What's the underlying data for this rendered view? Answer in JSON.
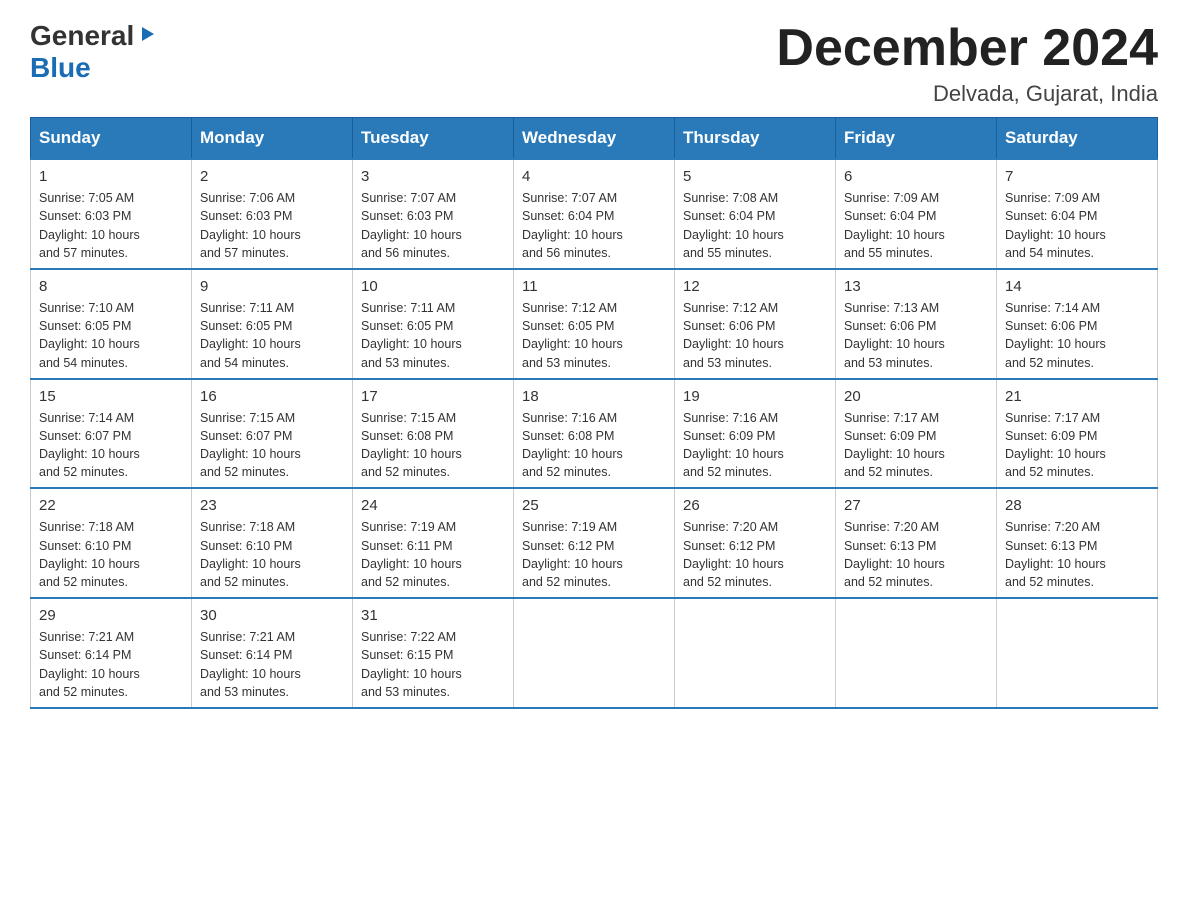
{
  "header": {
    "logo_general": "General",
    "logo_blue": "Blue",
    "month_title": "December 2024",
    "location": "Delvada, Gujarat, India"
  },
  "days_of_week": [
    "Sunday",
    "Monday",
    "Tuesday",
    "Wednesday",
    "Thursday",
    "Friday",
    "Saturday"
  ],
  "weeks": [
    [
      {
        "day": "1",
        "sunrise": "7:05 AM",
        "sunset": "6:03 PM",
        "daylight": "10 hours and 57 minutes."
      },
      {
        "day": "2",
        "sunrise": "7:06 AM",
        "sunset": "6:03 PM",
        "daylight": "10 hours and 57 minutes."
      },
      {
        "day": "3",
        "sunrise": "7:07 AM",
        "sunset": "6:03 PM",
        "daylight": "10 hours and 56 minutes."
      },
      {
        "day": "4",
        "sunrise": "7:07 AM",
        "sunset": "6:04 PM",
        "daylight": "10 hours and 56 minutes."
      },
      {
        "day": "5",
        "sunrise": "7:08 AM",
        "sunset": "6:04 PM",
        "daylight": "10 hours and 55 minutes."
      },
      {
        "day": "6",
        "sunrise": "7:09 AM",
        "sunset": "6:04 PM",
        "daylight": "10 hours and 55 minutes."
      },
      {
        "day": "7",
        "sunrise": "7:09 AM",
        "sunset": "6:04 PM",
        "daylight": "10 hours and 54 minutes."
      }
    ],
    [
      {
        "day": "8",
        "sunrise": "7:10 AM",
        "sunset": "6:05 PM",
        "daylight": "10 hours and 54 minutes."
      },
      {
        "day": "9",
        "sunrise": "7:11 AM",
        "sunset": "6:05 PM",
        "daylight": "10 hours and 54 minutes."
      },
      {
        "day": "10",
        "sunrise": "7:11 AM",
        "sunset": "6:05 PM",
        "daylight": "10 hours and 53 minutes."
      },
      {
        "day": "11",
        "sunrise": "7:12 AM",
        "sunset": "6:05 PM",
        "daylight": "10 hours and 53 minutes."
      },
      {
        "day": "12",
        "sunrise": "7:12 AM",
        "sunset": "6:06 PM",
        "daylight": "10 hours and 53 minutes."
      },
      {
        "day": "13",
        "sunrise": "7:13 AM",
        "sunset": "6:06 PM",
        "daylight": "10 hours and 53 minutes."
      },
      {
        "day": "14",
        "sunrise": "7:14 AM",
        "sunset": "6:06 PM",
        "daylight": "10 hours and 52 minutes."
      }
    ],
    [
      {
        "day": "15",
        "sunrise": "7:14 AM",
        "sunset": "6:07 PM",
        "daylight": "10 hours and 52 minutes."
      },
      {
        "day": "16",
        "sunrise": "7:15 AM",
        "sunset": "6:07 PM",
        "daylight": "10 hours and 52 minutes."
      },
      {
        "day": "17",
        "sunrise": "7:15 AM",
        "sunset": "6:08 PM",
        "daylight": "10 hours and 52 minutes."
      },
      {
        "day": "18",
        "sunrise": "7:16 AM",
        "sunset": "6:08 PM",
        "daylight": "10 hours and 52 minutes."
      },
      {
        "day": "19",
        "sunrise": "7:16 AM",
        "sunset": "6:09 PM",
        "daylight": "10 hours and 52 minutes."
      },
      {
        "day": "20",
        "sunrise": "7:17 AM",
        "sunset": "6:09 PM",
        "daylight": "10 hours and 52 minutes."
      },
      {
        "day": "21",
        "sunrise": "7:17 AM",
        "sunset": "6:09 PM",
        "daylight": "10 hours and 52 minutes."
      }
    ],
    [
      {
        "day": "22",
        "sunrise": "7:18 AM",
        "sunset": "6:10 PM",
        "daylight": "10 hours and 52 minutes."
      },
      {
        "day": "23",
        "sunrise": "7:18 AM",
        "sunset": "6:10 PM",
        "daylight": "10 hours and 52 minutes."
      },
      {
        "day": "24",
        "sunrise": "7:19 AM",
        "sunset": "6:11 PM",
        "daylight": "10 hours and 52 minutes."
      },
      {
        "day": "25",
        "sunrise": "7:19 AM",
        "sunset": "6:12 PM",
        "daylight": "10 hours and 52 minutes."
      },
      {
        "day": "26",
        "sunrise": "7:20 AM",
        "sunset": "6:12 PM",
        "daylight": "10 hours and 52 minutes."
      },
      {
        "day": "27",
        "sunrise": "7:20 AM",
        "sunset": "6:13 PM",
        "daylight": "10 hours and 52 minutes."
      },
      {
        "day": "28",
        "sunrise": "7:20 AM",
        "sunset": "6:13 PM",
        "daylight": "10 hours and 52 minutes."
      }
    ],
    [
      {
        "day": "29",
        "sunrise": "7:21 AM",
        "sunset": "6:14 PM",
        "daylight": "10 hours and 52 minutes."
      },
      {
        "day": "30",
        "sunrise": "7:21 AM",
        "sunset": "6:14 PM",
        "daylight": "10 hours and 53 minutes."
      },
      {
        "day": "31",
        "sunrise": "7:22 AM",
        "sunset": "6:15 PM",
        "daylight": "10 hours and 53 minutes."
      },
      null,
      null,
      null,
      null
    ]
  ],
  "labels": {
    "sunrise": "Sunrise:",
    "sunset": "Sunset:",
    "daylight": "Daylight:"
  }
}
